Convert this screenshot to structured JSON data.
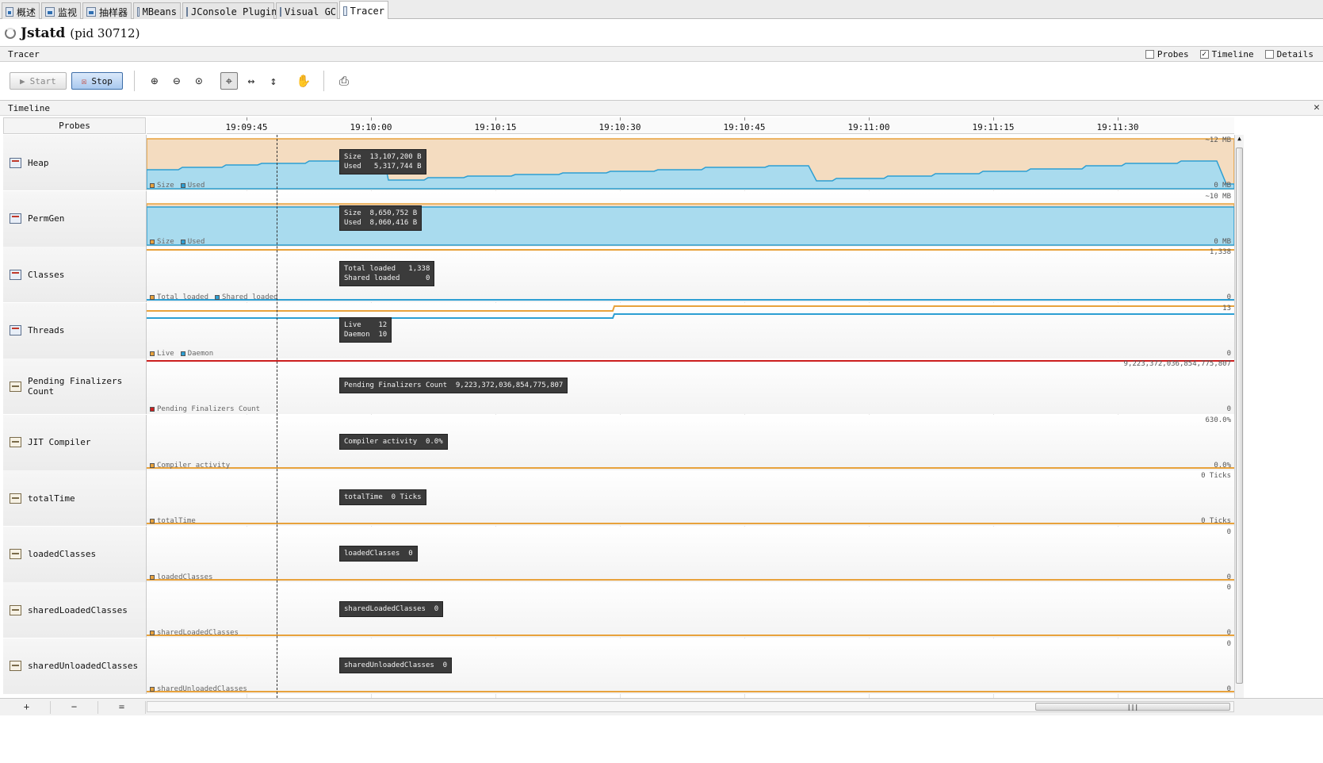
{
  "tabs": [
    {
      "label": "概述",
      "active": false
    },
    {
      "label": "监视",
      "active": false
    },
    {
      "label": "抽样器",
      "active": false
    },
    {
      "label": "MBeans",
      "active": false
    },
    {
      "label": "JConsole Plugins",
      "active": false
    },
    {
      "label": "Visual GC",
      "active": false
    },
    {
      "label": "Tracer",
      "active": true
    }
  ],
  "title": {
    "app": "Jstatd",
    "pid": "(pid 30712)"
  },
  "tracer": {
    "label": "Tracer",
    "options": [
      {
        "label": "Probes",
        "checked": false
      },
      {
        "label": "Timeline",
        "checked": true
      },
      {
        "label": "Details",
        "checked": false
      }
    ]
  },
  "toolbar": {
    "start_label": "Start",
    "stop_label": "Stop"
  },
  "timeline": {
    "label": "Timeline",
    "close_glyph": "✕",
    "probes_header": "Probes",
    "ticks": [
      "19:09:45",
      "19:10:00",
      "19:10:15",
      "19:10:30",
      "19:10:45",
      "19:11:00",
      "19:11:15",
      "19:11:30"
    ]
  },
  "rows": [
    {
      "name": "Heap",
      "icon": "chart-icon",
      "legend": [
        {
          "label": "Size",
          "color": "#e8a23c"
        },
        {
          "label": "Used",
          "color": "#2d9fd3"
        }
      ],
      "max": "~12 MB",
      "min": "0 MB",
      "tooltip": "Size  13,107,200 B\nUsed   5,317,744 B"
    },
    {
      "name": "PermGen",
      "icon": "chart-icon",
      "legend": [
        {
          "label": "Size",
          "color": "#e8a23c"
        },
        {
          "label": "Used",
          "color": "#2d9fd3"
        }
      ],
      "max": "~10 MB",
      "min": "0 MB",
      "tooltip": "Size  8,650,752 B\nUsed  8,060,416 B"
    },
    {
      "name": "Classes",
      "icon": "chart-icon",
      "legend": [
        {
          "label": "Total loaded",
          "color": "#e8a23c"
        },
        {
          "label": "Shared loaded",
          "color": "#2d9fd3"
        }
      ],
      "max": "1,338",
      "min": "0",
      "tooltip": "Total loaded   1,338\nShared loaded      0"
    },
    {
      "name": "Threads",
      "icon": "chart-icon",
      "legend": [
        {
          "label": "Live",
          "color": "#e8a23c"
        },
        {
          "label": "Daemon",
          "color": "#2d9fd3"
        }
      ],
      "max": "13",
      "min": "0",
      "tooltip": "Live    12\nDaemon  10"
    },
    {
      "name": "Pending Finalizers Count",
      "icon": "probe-icon",
      "legend": [
        {
          "label": "Pending Finalizers Count",
          "color": "#cc1f1f"
        }
      ],
      "max": "9,223,372,036,854,775,807",
      "min": "0",
      "tooltip": "Pending Finalizers Count  9,223,372,036,854,775,807"
    },
    {
      "name": "JIT Compiler",
      "icon": "compiler-icon",
      "legend": [
        {
          "label": "Compiler activity",
          "color": "#e8a23c"
        }
      ],
      "max": "630.0%",
      "min": "0.0%",
      "tooltip": "Compiler activity  0.0%"
    },
    {
      "name": "totalTime",
      "icon": "probe-icon",
      "legend": [
        {
          "label": "totalTime",
          "color": "#e8a23c"
        }
      ],
      "max": "0 Ticks",
      "min": "0 Ticks",
      "tooltip": "totalTime  0 Ticks"
    },
    {
      "name": "loadedClasses",
      "icon": "probe-icon",
      "legend": [
        {
          "label": "loadedClasses",
          "color": "#e8a23c"
        }
      ],
      "max": "0",
      "min": "0",
      "tooltip": "loadedClasses  0"
    },
    {
      "name": "sharedLoadedClasses",
      "icon": "probe-icon",
      "legend": [
        {
          "label": "sharedLoadedClasses",
          "color": "#e8a23c"
        }
      ],
      "max": "0",
      "min": "0",
      "tooltip": "sharedLoadedClasses  0"
    },
    {
      "name": "sharedUnloadedClasses",
      "icon": "probe-icon",
      "legend": [
        {
          "label": "sharedUnloadedClasses",
          "color": "#e8a23c"
        }
      ],
      "max": "0",
      "min": "0",
      "tooltip": "sharedUnloadedClasses  0"
    }
  ],
  "bottom": {
    "add": "+",
    "remove": "−",
    "fit": "="
  }
}
